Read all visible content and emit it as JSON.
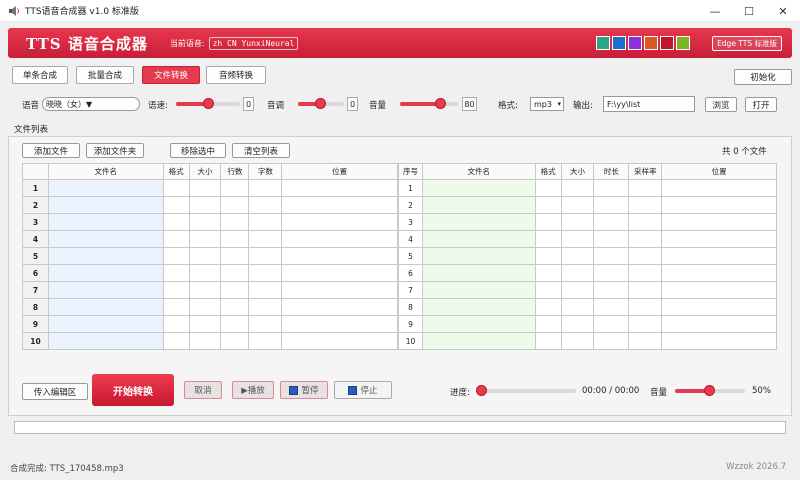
{
  "window": {
    "title": "TTS语音合成器 v1.0  标准版",
    "min": "—",
    "max": "☐",
    "close": "✕"
  },
  "banner": {
    "brand": "TTS 语音合成器",
    "current_label": "当前语音:",
    "current_value": "zh CN YunxiNeural",
    "edition": "Edge TTS 标准版",
    "swatches": [
      "#2aa58a",
      "#1e6fd0",
      "#8b32d6",
      "#d85a22",
      "#c0162c",
      "#7ab51f"
    ]
  },
  "tabs": [
    {
      "label": "单条合成",
      "active": false
    },
    {
      "label": "批量合成",
      "active": false
    },
    {
      "label": "文件转换",
      "active": true
    },
    {
      "label": "音频转换",
      "active": false
    }
  ],
  "init_button": "初始化",
  "controls": {
    "voice_label": "语音",
    "voice_value": "晓晓（女）▼",
    "rate_label": "语速:",
    "rate_value": "0",
    "pitch_label": "音调",
    "pitch_value": "0",
    "volume_label": "音量",
    "volume_value": "80",
    "format_label": "格式:",
    "format_value": "mp3",
    "output_label": "输出:",
    "output_path": "F:\\yy\\list",
    "browse": "浏览",
    "open": "打开"
  },
  "file_list": {
    "label": "文件列表",
    "add_file": "添加文件",
    "add_folder": "添加文件夹",
    "remove_selected": "移除选中",
    "clear_list": "清空列表",
    "count_text": "共 0 个文件"
  },
  "left_table": {
    "headers": [
      "",
      "文件名",
      "格式",
      "大小",
      "行数",
      "字数",
      "位置"
    ],
    "rows": [
      "1",
      "2",
      "3",
      "4",
      "5",
      "6",
      "7",
      "8",
      "9",
      "10"
    ]
  },
  "right_table": {
    "headers": [
      "序号",
      "文件名",
      "格式",
      "大小",
      "时长",
      "采样率",
      "位置"
    ],
    "rows": [
      "1",
      "2",
      "3",
      "4",
      "5",
      "6",
      "7",
      "8",
      "9",
      "10"
    ]
  },
  "actions": {
    "import_editor": "传入编辑区",
    "start": "开始转换",
    "cancel": "取消",
    "play": "▶播放",
    "pause": "暂停",
    "stop": "停止"
  },
  "player": {
    "progress_label": "进度:",
    "time": "00:00 / 00:00",
    "volume_label": "音量",
    "volume_pct": "50%",
    "progress_fraction": 0.0,
    "volume_fraction": 0.5
  },
  "status": {
    "left": "合成完成: TTS_170458.mp3",
    "right": "Wzzok 2026.7"
  }
}
